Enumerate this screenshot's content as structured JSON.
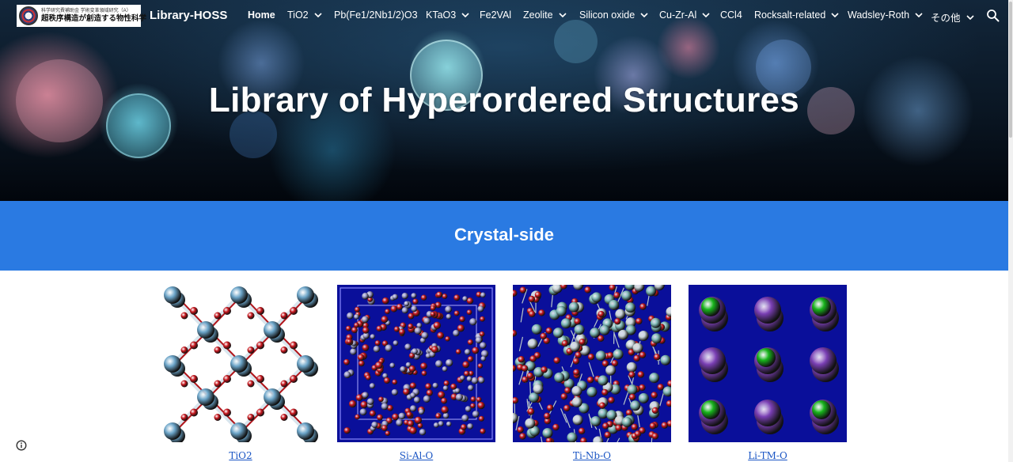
{
  "header": {
    "logo_line1": "科学研究費補助金 学術変革領域研究（A）",
    "logo_line2": "超秩序構造が創造する物性科学",
    "site_title": "Library-HOSS",
    "search_icon": "search-icon"
  },
  "nav": {
    "items": [
      {
        "label": "Home",
        "dropdown": false,
        "active": true
      },
      {
        "label": "TiO2",
        "dropdown": true
      },
      {
        "label": "Pb(Fe1/2Nb1/2)O3",
        "dropdown": false
      },
      {
        "label": "KTaO3",
        "dropdown": true
      },
      {
        "label": "Fe2VAl",
        "dropdown": false
      },
      {
        "label": "Zeolite",
        "dropdown": true
      },
      {
        "label": "Silicon oxide",
        "dropdown": true
      },
      {
        "label": "Cu-Zr-Al",
        "dropdown": true
      },
      {
        "label": "CCl4",
        "dropdown": false
      },
      {
        "label": "Rocksalt-related",
        "dropdown": true
      },
      {
        "label": "Wadsley-Roth",
        "dropdown": true
      },
      {
        "label": "その他",
        "dropdown": true
      }
    ]
  },
  "hero": {
    "title": "Library of Hyperordered Structures"
  },
  "section": {
    "title": "Crystal-side"
  },
  "cards": [
    {
      "label": "TiO2",
      "image": "tio2-structure"
    },
    {
      "label": "Si-Al-O",
      "image": "si-al-o-structure"
    },
    {
      "label": "Ti-Nb-O",
      "image": "ti-nb-o-structure"
    },
    {
      "label": "Li-TM-O",
      "image": "li-tm-o-structure"
    }
  ],
  "colors": {
    "band_blue": "#2a7ae2",
    "link_blue": "#1a55c4",
    "oxygen_red": "#c8161d",
    "titanium_blue": "#6aa3c7",
    "sim_box_blue": "#0a0f9a",
    "chlorine_green": "#18b51c",
    "metal_purple": "#7a3fb4"
  }
}
